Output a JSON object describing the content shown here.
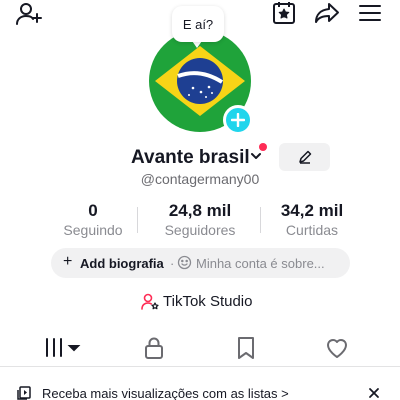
{
  "topbar": {
    "add_user_icon": "add-user-icon",
    "calendar_icon": "calendar-star-icon",
    "share_icon": "share-arrow-icon",
    "menu_icon": "hamburger-menu-icon"
  },
  "avatar": {
    "bubble_text": "E aí?",
    "image": "brazil-flag",
    "add_icon": "plus-icon"
  },
  "profile": {
    "name": "Avante brasil",
    "handle": "@contagermany00",
    "notification_color": "#fe2c55"
  },
  "stats": [
    {
      "value": "0",
      "label": "Seguindo"
    },
    {
      "value": "24,8 mil",
      "label": "Seguidores"
    },
    {
      "value": "34,2 mil",
      "label": "Curtidas"
    }
  ],
  "bio": {
    "plus": "+",
    "add_label": "Add biografia",
    "separator": "·",
    "prompt": "Minha conta é sobre..."
  },
  "studio": {
    "label": "TikTok Studio"
  },
  "tabs": [
    "videos-grid-icon",
    "lock-icon",
    "repost-bookmark-icon",
    "heart-icon"
  ],
  "banner": {
    "text": "Receba mais visualizações com as listas  >",
    "close_icon": "close-icon"
  },
  "colors": {
    "accent": "#20d5ec",
    "brand_red": "#fe2c55"
  }
}
